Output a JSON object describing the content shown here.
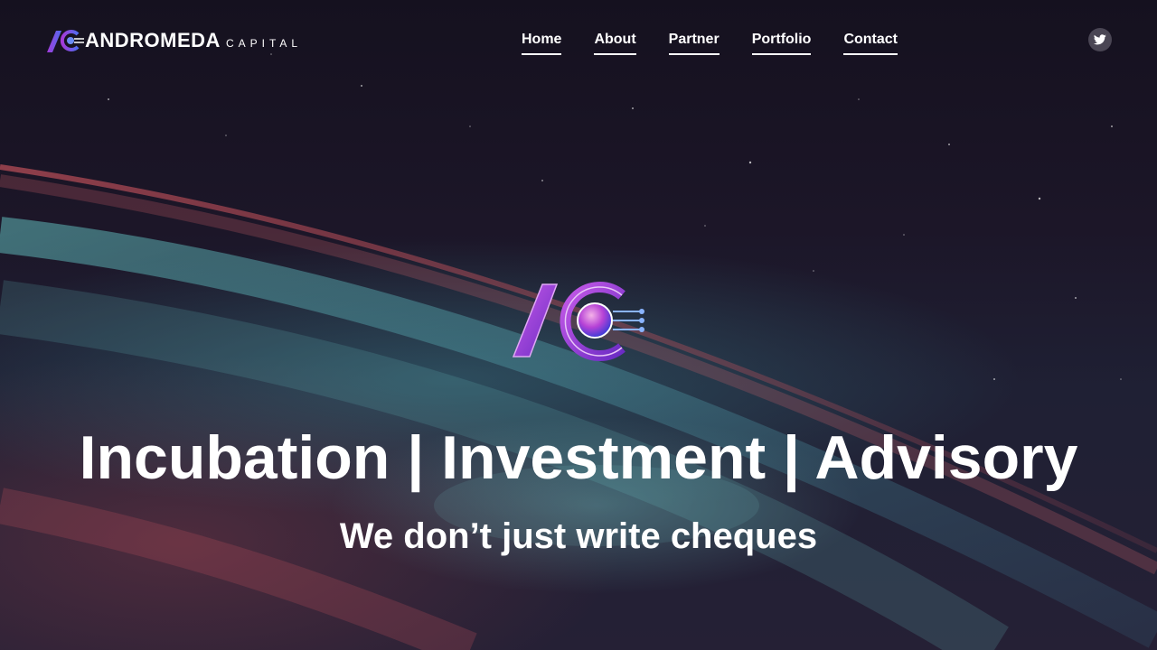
{
  "brand": {
    "name": "ANDROMEDA",
    "sub": "CAPITAL",
    "mark_icon": "ac-logo-icon"
  },
  "nav": {
    "items": [
      {
        "label": "Home"
      },
      {
        "label": "About"
      },
      {
        "label": "Partner"
      },
      {
        "label": "Portfolio"
      },
      {
        "label": "Contact"
      }
    ]
  },
  "social": {
    "icon": "twitter-icon"
  },
  "hero": {
    "logo_icon": "ac-planet-logo-icon",
    "headline": "Incubation | Investment | Advisory",
    "subline": "We don’t just write cheques"
  },
  "colors": {
    "text": "#ffffff",
    "brand_purple": "#a43ad8",
    "brand_blue": "#4f6cf0",
    "nebula_teal": "#5fb8b8",
    "nebula_red": "#c0505a",
    "sky": "#15111f"
  }
}
